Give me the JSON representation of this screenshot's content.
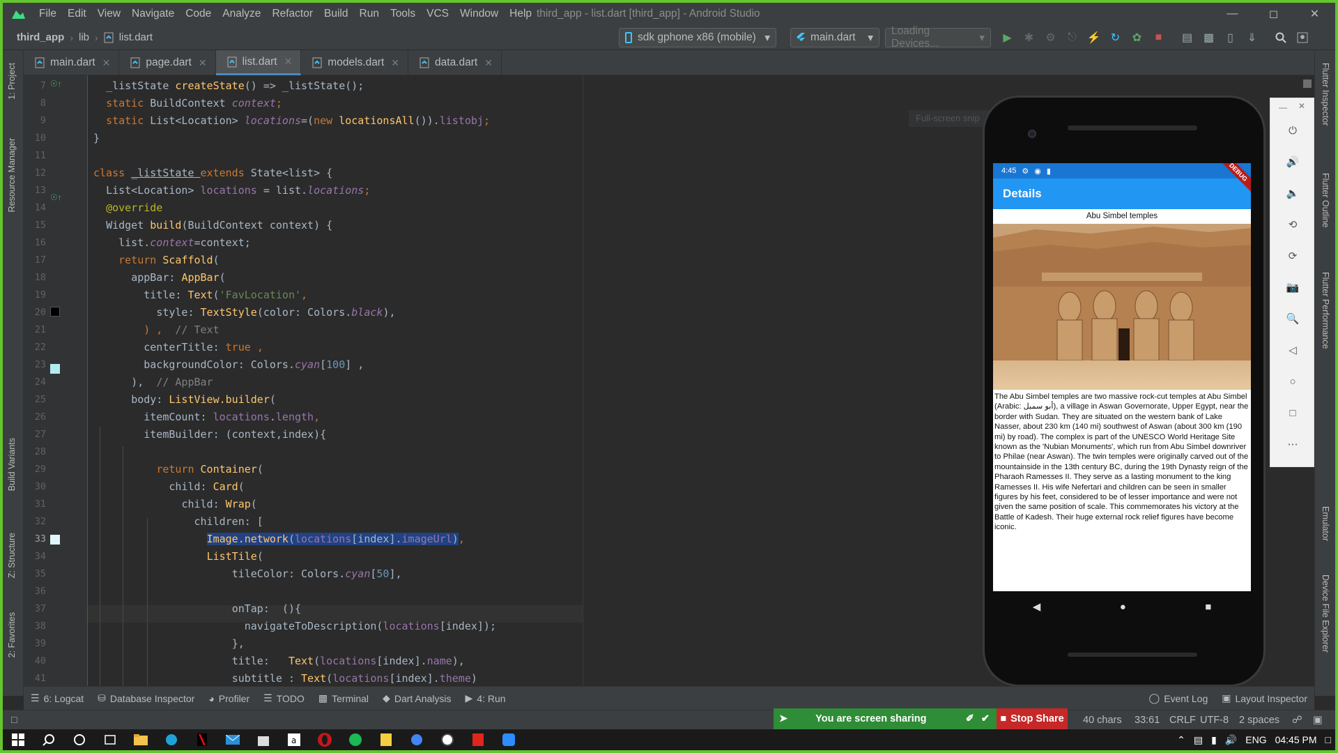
{
  "menu": [
    "File",
    "Edit",
    "View",
    "Navigate",
    "Code",
    "Analyze",
    "Refactor",
    "Build",
    "Run",
    "Tools",
    "VCS",
    "Window",
    "Help"
  ],
  "window_title": "third_app - list.dart [third_app] - Android Studio",
  "breadcrumb": {
    "project": "third_app",
    "folder": "lib",
    "file": "list.dart"
  },
  "device_combo": "sdk gphone x86 (mobile)",
  "run_config": "main.dart",
  "loading_devices": "Loading Devices...",
  "tabs": [
    {
      "label": "main.dart"
    },
    {
      "label": "page.dart"
    },
    {
      "label": "list.dart"
    },
    {
      "label": "models.dart"
    },
    {
      "label": "data.dart"
    }
  ],
  "left_tools": [
    "1: Project",
    "Resource Manager",
    "Build Variants",
    "Z: Structure",
    "2: Favorites"
  ],
  "right_tools": [
    "Flutter Inspector",
    "Flutter Outline",
    "Flutter Performance",
    "Emulator",
    "Device File Explorer"
  ],
  "line_numbers": [
    "7",
    "8",
    "9",
    "10",
    "11",
    "12",
    "13",
    "14",
    "15",
    "16",
    "17",
    "18",
    "19",
    "20",
    "21",
    "22",
    "23",
    "24",
    "25",
    "26",
    "27",
    "28",
    "29",
    "30",
    "31",
    "32",
    "33",
    "34",
    "35",
    "36",
    "37",
    "38",
    "39",
    "40",
    "41"
  ],
  "code": {
    "l7": [
      "_listState ",
      "createState",
      "() => _listState();"
    ],
    "l8": [
      "static ",
      "BuildContext ",
      "context",
      ";"
    ],
    "l9": [
      "static ",
      "List<Location> ",
      "locations",
      "=(",
      "new ",
      "locationsAll",
      "()).",
      "listobj",
      ";"
    ],
    "l10": "}",
    "l12": [
      "class ",
      "_listState ",
      "extends ",
      "State<list> {"
    ],
    "l13": [
      "List<Location> ",
      "locations ",
      "= list.",
      "locations",
      ";"
    ],
    "l14": "@override",
    "l15": [
      "Widget ",
      "build",
      "(BuildContext context) {"
    ],
    "l16": [
      "list.",
      "context",
      "=context;"
    ],
    "l17": [
      "return ",
      "Scaffold",
      "("
    ],
    "l18": [
      "appBar: ",
      "AppBar",
      "("
    ],
    "l19": [
      "title: ",
      "Text",
      "(",
      "'FavLocation'",
      ","
    ],
    "l20": [
      "style: ",
      "TextStyle",
      "(color: Colors.",
      "black",
      "),"
    ],
    "l21": [
      ") ,  ",
      "// Text"
    ],
    "l22": [
      "centerTitle: ",
      "true ",
      ","
    ],
    "l23": [
      "backgroundColor: Colors.",
      "cyan",
      "[",
      "100",
      "] ,"
    ],
    "l24": [
      "),  ",
      "// AppBar"
    ],
    "l25": [
      "body: ",
      "ListView.builder",
      "("
    ],
    "l26": [
      "itemCount: ",
      "locations",
      ".",
      "length",
      ","
    ],
    "l27": "itemBuilder: (context,index){",
    "l29": [
      "return ",
      "Container",
      "("
    ],
    "l30": [
      "child: ",
      "Card",
      "("
    ],
    "l31": [
      "child: ",
      "Wrap",
      "("
    ],
    "l32": "children: [",
    "l33": [
      "Image.network",
      "(",
      "locations",
      "[index].",
      "imageUrl",
      ")",
      ","
    ],
    "l34": [
      "ListTile",
      "("
    ],
    "l35": [
      "tileColor: Colors.",
      "cyan",
      "[",
      "50",
      "],"
    ],
    "l37": "onTap:  (){",
    "l38": [
      "navigateToDescription(",
      "locations",
      "[index]);"
    ],
    "l39": "},",
    "l40": [
      "title:   ",
      "Text",
      "(",
      "locations",
      "[index].",
      "name",
      "),"
    ],
    "l41": [
      "subtitle : ",
      "Text",
      "(",
      "locations",
      "[index].",
      "theme",
      ")"
    ]
  },
  "emulator": {
    "ghost_tip": "Full-screen snip",
    "status_time": "4:45",
    "app_title": "Details",
    "debug_banner": "DEBUG",
    "place_title": "Abu Simbel temples",
    "description": "The Abu Simbel temples are two massive rock-cut temples at Abu Simbel (Arabic: أبو سمبل), a village in Aswan Governorate, Upper Egypt, near the border with Sudan. They are situated on the western bank of Lake Nasser, about 230 km (140 mi) southwest of Aswan (about 300 km (190 mi) by road). The complex is part of the UNESCO World Heritage Site known as the 'Nubian Monuments', which run from Abu Simbel downriver to Philae (near Aswan). The twin temples were originally carved out of the mountainside in the 13th century BC, during the 19th Dynasty reign of the Pharaoh Ramesses II. They serve as a lasting monument to the king Ramesses II. His wife Nefertari and children can be seen in smaller figures by his feet, considered to be of lesser importance and were not given the same position of scale. This commemorates his victory at the Battle of Kadesh. Their huge external rock relief figures have become iconic."
  },
  "toolwindows": [
    {
      "label": "6: Logcat"
    },
    {
      "label": "Database Inspector"
    },
    {
      "label": "Profiler"
    },
    {
      "label": "TODO"
    },
    {
      "label": "Terminal"
    },
    {
      "label": "Dart Analysis"
    },
    {
      "label": "4: Run"
    }
  ],
  "event_log": "Event Log",
  "layout_inspector": "Layout Inspector",
  "share": {
    "text": "You are screen sharing",
    "stop": "Stop Share"
  },
  "status": {
    "chars": "40 chars",
    "pos": "33:61",
    "eol": "CRLF",
    "enc": "UTF-8",
    "indent": "2 spaces"
  },
  "tray": {
    "lang": "ENG",
    "time": "04:45 PM"
  },
  "colors": {
    "accent": "#4a88c7",
    "share_green": "#2f8c37",
    "stop_red": "#c62828",
    "appbar": "#2196f3"
  }
}
